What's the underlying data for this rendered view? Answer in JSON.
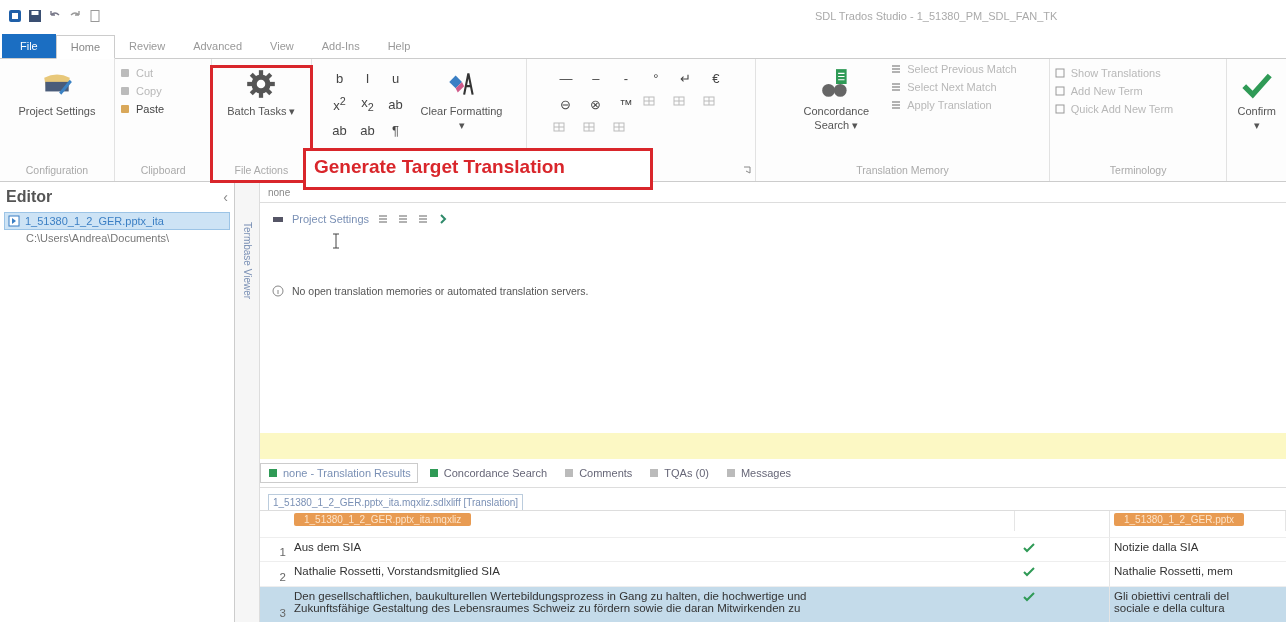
{
  "window": {
    "title": "SDL Trados Studio - 1_51380_PM_SDL_FAN_TK"
  },
  "file_button": {
    "label": "File"
  },
  "ribbon_tabs": [
    {
      "label": "Home",
      "selected": true
    },
    {
      "label": "Review",
      "selected": false
    },
    {
      "label": "Advanced",
      "selected": false
    },
    {
      "label": "View",
      "selected": false
    },
    {
      "label": "Add-Ins",
      "selected": false
    },
    {
      "label": "Help",
      "selected": false
    }
  ],
  "ribbon": {
    "configuration": {
      "button": "Project Settings",
      "label": "Configuration"
    },
    "clipboard": {
      "items": [
        {
          "label": "Cut",
          "disabled": true
        },
        {
          "label": "Copy",
          "disabled": true
        },
        {
          "label": "Paste",
          "disabled": false
        }
      ],
      "label": "Clipboard"
    },
    "file_actions": {
      "button": "Batch Tasks ▾",
      "label": "File Actions",
      "highlighted": true
    },
    "formatting": {
      "glyphs": [
        "b",
        "I",
        "u",
        "x$^{2}$",
        "x$_{2}$",
        "ab",
        "ab",
        "ab",
        "¶"
      ],
      "button": "Clear Formatting ▾"
    },
    "quick_insert": {
      "glyphs": [
        "—",
        "–",
        "‑",
        "°",
        "↵",
        "€",
        "⊖",
        "⊗",
        "™"
      ]
    },
    "translation_memory": {
      "button": "Concordance Search ▾",
      "items": [
        {
          "label": "Select Previous Match",
          "disabled": true
        },
        {
          "label": "Select Next Match",
          "disabled": true
        },
        {
          "label": "Apply Translation",
          "disabled": true
        }
      ],
      "label": "Translation Memory"
    },
    "terminology": {
      "items": [
        {
          "label": "Show Translations",
          "disabled": true
        },
        {
          "label": "Add New Term",
          "disabled": true
        },
        {
          "label": "Quick Add New Term",
          "disabled": true
        }
      ],
      "label": "Terminology"
    },
    "confirm": {
      "button": "Confirm ▾"
    }
  },
  "callout": {
    "text": "Generate Target Translation"
  },
  "navigation": {
    "title": "Editor",
    "collapse": "‹",
    "items": [
      {
        "label": "1_51380_1_2_GER.pptx_ita",
        "selected": true,
        "children": [
          {
            "label": "C:\\Users\\Andrea\\Documents\\",
            "selected": false
          }
        ]
      }
    ]
  },
  "side_tab": {
    "label": "Termbase Viewer"
  },
  "editor": {
    "tab": "none",
    "toolbar": {
      "label": "Project Settings"
    },
    "message": "No open translation memories or automated translation servers."
  },
  "results_tabs": [
    {
      "label": "none - Translation Results",
      "selected": true
    },
    {
      "label": "Concordance Search",
      "selected": false
    },
    {
      "label": "Comments",
      "selected": false
    },
    {
      "label": "TQAs (0)",
      "selected": false
    },
    {
      "label": "Messages",
      "selected": false
    }
  ],
  "document_tab": {
    "label": "1_51380_1_2_GER.pptx_ita.mqxliz.sdlxliff [Translation]"
  },
  "segments": {
    "source_file": "1_51380_1_2_GER.pptx_ita.mqxliz",
    "target_file": "1_51380_1_2_GER.pptx",
    "rows": [
      {
        "number": "1",
        "source": [
          "Aus dem SIA"
        ],
        "confirmed": true,
        "target": [
          "Notizie dalla SIA"
        ],
        "selected": false
      },
      {
        "number": "2",
        "source": [
          "Nathalie Rossetti, Vorstandsmitglied SIA"
        ],
        "confirmed": true,
        "target": [
          "Nathalie Rossetti, mem"
        ],
        "selected": false
      },
      {
        "number": "3",
        "source": [
          "Den gesellschaftlichen, baukulturellen Wertebildungsprozess in Gang zu halten, die hochwertige und",
          "Zukunftsfähige Gestaltung des Lebensraumes Schweiz zu fördern sowie die daran Mitwirkenden zu"
        ],
        "confirmed": true,
        "target": [
          "Gli obiettivi centrali del",
          "sociale e della cultura"
        ],
        "selected": true
      }
    ]
  }
}
